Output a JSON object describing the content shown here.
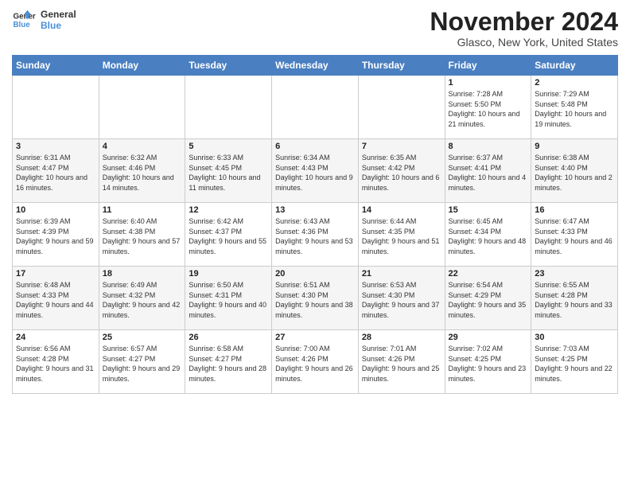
{
  "header": {
    "logo_line1": "General",
    "logo_line2": "Blue",
    "month_title": "November 2024",
    "location": "Glasco, New York, United States"
  },
  "days_of_week": [
    "Sunday",
    "Monday",
    "Tuesday",
    "Wednesday",
    "Thursday",
    "Friday",
    "Saturday"
  ],
  "weeks": [
    [
      {
        "day": "",
        "info": ""
      },
      {
        "day": "",
        "info": ""
      },
      {
        "day": "",
        "info": ""
      },
      {
        "day": "",
        "info": ""
      },
      {
        "day": "",
        "info": ""
      },
      {
        "day": "1",
        "info": "Sunrise: 7:28 AM\nSunset: 5:50 PM\nDaylight: 10 hours and 21 minutes."
      },
      {
        "day": "2",
        "info": "Sunrise: 7:29 AM\nSunset: 5:48 PM\nDaylight: 10 hours and 19 minutes."
      }
    ],
    [
      {
        "day": "3",
        "info": "Sunrise: 6:31 AM\nSunset: 4:47 PM\nDaylight: 10 hours and 16 minutes."
      },
      {
        "day": "4",
        "info": "Sunrise: 6:32 AM\nSunset: 4:46 PM\nDaylight: 10 hours and 14 minutes."
      },
      {
        "day": "5",
        "info": "Sunrise: 6:33 AM\nSunset: 4:45 PM\nDaylight: 10 hours and 11 minutes."
      },
      {
        "day": "6",
        "info": "Sunrise: 6:34 AM\nSunset: 4:43 PM\nDaylight: 10 hours and 9 minutes."
      },
      {
        "day": "7",
        "info": "Sunrise: 6:35 AM\nSunset: 4:42 PM\nDaylight: 10 hours and 6 minutes."
      },
      {
        "day": "8",
        "info": "Sunrise: 6:37 AM\nSunset: 4:41 PM\nDaylight: 10 hours and 4 minutes."
      },
      {
        "day": "9",
        "info": "Sunrise: 6:38 AM\nSunset: 4:40 PM\nDaylight: 10 hours and 2 minutes."
      }
    ],
    [
      {
        "day": "10",
        "info": "Sunrise: 6:39 AM\nSunset: 4:39 PM\nDaylight: 9 hours and 59 minutes."
      },
      {
        "day": "11",
        "info": "Sunrise: 6:40 AM\nSunset: 4:38 PM\nDaylight: 9 hours and 57 minutes."
      },
      {
        "day": "12",
        "info": "Sunrise: 6:42 AM\nSunset: 4:37 PM\nDaylight: 9 hours and 55 minutes."
      },
      {
        "day": "13",
        "info": "Sunrise: 6:43 AM\nSunset: 4:36 PM\nDaylight: 9 hours and 53 minutes."
      },
      {
        "day": "14",
        "info": "Sunrise: 6:44 AM\nSunset: 4:35 PM\nDaylight: 9 hours and 51 minutes."
      },
      {
        "day": "15",
        "info": "Sunrise: 6:45 AM\nSunset: 4:34 PM\nDaylight: 9 hours and 48 minutes."
      },
      {
        "day": "16",
        "info": "Sunrise: 6:47 AM\nSunset: 4:33 PM\nDaylight: 9 hours and 46 minutes."
      }
    ],
    [
      {
        "day": "17",
        "info": "Sunrise: 6:48 AM\nSunset: 4:33 PM\nDaylight: 9 hours and 44 minutes."
      },
      {
        "day": "18",
        "info": "Sunrise: 6:49 AM\nSunset: 4:32 PM\nDaylight: 9 hours and 42 minutes."
      },
      {
        "day": "19",
        "info": "Sunrise: 6:50 AM\nSunset: 4:31 PM\nDaylight: 9 hours and 40 minutes."
      },
      {
        "day": "20",
        "info": "Sunrise: 6:51 AM\nSunset: 4:30 PM\nDaylight: 9 hours and 38 minutes."
      },
      {
        "day": "21",
        "info": "Sunrise: 6:53 AM\nSunset: 4:30 PM\nDaylight: 9 hours and 37 minutes."
      },
      {
        "day": "22",
        "info": "Sunrise: 6:54 AM\nSunset: 4:29 PM\nDaylight: 9 hours and 35 minutes."
      },
      {
        "day": "23",
        "info": "Sunrise: 6:55 AM\nSunset: 4:28 PM\nDaylight: 9 hours and 33 minutes."
      }
    ],
    [
      {
        "day": "24",
        "info": "Sunrise: 6:56 AM\nSunset: 4:28 PM\nDaylight: 9 hours and 31 minutes."
      },
      {
        "day": "25",
        "info": "Sunrise: 6:57 AM\nSunset: 4:27 PM\nDaylight: 9 hours and 29 minutes."
      },
      {
        "day": "26",
        "info": "Sunrise: 6:58 AM\nSunset: 4:27 PM\nDaylight: 9 hours and 28 minutes."
      },
      {
        "day": "27",
        "info": "Sunrise: 7:00 AM\nSunset: 4:26 PM\nDaylight: 9 hours and 26 minutes."
      },
      {
        "day": "28",
        "info": "Sunrise: 7:01 AM\nSunset: 4:26 PM\nDaylight: 9 hours and 25 minutes."
      },
      {
        "day": "29",
        "info": "Sunrise: 7:02 AM\nSunset: 4:25 PM\nDaylight: 9 hours and 23 minutes."
      },
      {
        "day": "30",
        "info": "Sunrise: 7:03 AM\nSunset: 4:25 PM\nDaylight: 9 hours and 22 minutes."
      }
    ]
  ]
}
